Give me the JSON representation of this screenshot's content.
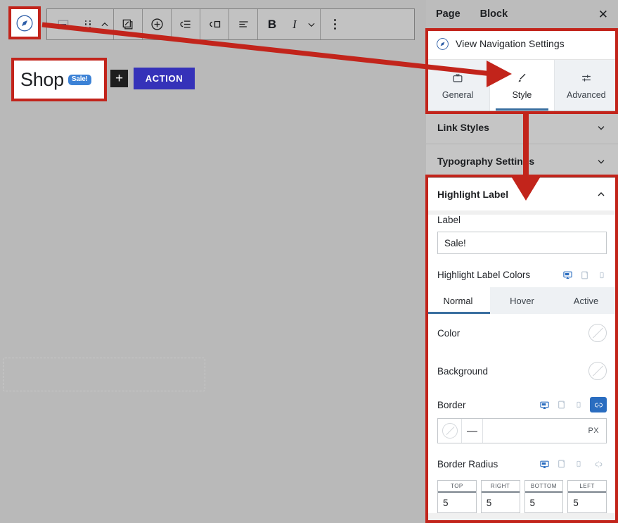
{
  "app": {
    "background_color": "#b9b9b9",
    "accent_color": "#2a6dc0",
    "annotation_color": "#c2241b"
  },
  "canvas": {
    "nav_icon": "compass-icon",
    "toolbar": {
      "groups": [
        {
          "buttons": [
            {
              "icon": "block-type-navigation-icon",
              "label": ""
            },
            {
              "icon": "drag-handle-icon",
              "label": ""
            },
            {
              "icon": "move-up-icon",
              "label": ""
            }
          ]
        },
        {
          "buttons": [
            {
              "icon": "edit-overlay-icon",
              "label": ""
            }
          ]
        },
        {
          "buttons": [
            {
              "icon": "add-circle-icon",
              "label": ""
            }
          ]
        },
        {
          "buttons": [
            {
              "icon": "indent-list-icon",
              "label": ""
            }
          ]
        },
        {
          "buttons": [
            {
              "icon": "submenu-icon",
              "label": ""
            }
          ]
        },
        {
          "buttons": [
            {
              "icon": "align-icon",
              "label": ""
            }
          ]
        },
        {
          "buttons": [
            {
              "icon": "bold-icon",
              "label": "B"
            },
            {
              "icon": "italic-icon",
              "label": "I"
            },
            {
              "icon": "chevron-down-icon",
              "label": ""
            }
          ]
        },
        {
          "buttons": [
            {
              "icon": "more-options-icon",
              "label": ""
            }
          ]
        }
      ]
    },
    "menu_block": {
      "item_label": "Shop",
      "highlight_badge": "Sale!",
      "add_button": "+",
      "action_button": "ACTION"
    }
  },
  "panel": {
    "header": {
      "tab_page": "Page",
      "tab_block": "Block",
      "close_icon": "close-icon"
    },
    "nav_settings": {
      "icon": "compass-icon",
      "title": "View Navigation Settings"
    },
    "segment_tabs": [
      {
        "label": "General",
        "icon": "general-box-icon",
        "active": false
      },
      {
        "label": "Style",
        "icon": "brush-icon",
        "active": true
      },
      {
        "label": "Advanced",
        "icon": "sliders-icon",
        "active": false
      }
    ],
    "accordions": [
      {
        "title": "Link Styles",
        "open": false,
        "chevron": "chevron-down-icon"
      },
      {
        "title": "Typography Settings",
        "open": false,
        "chevron": "chevron-down-icon"
      }
    ],
    "highlight_label_section": {
      "title": "Highlight Label",
      "chevron": "chevron-up-icon",
      "label_field": {
        "label": "Label",
        "value": "Sale!",
        "placeholder": "Sale!"
      },
      "colors": {
        "title": "Highlight Label Colors",
        "devices": [
          {
            "name": "desktop-icon",
            "active": true
          },
          {
            "name": "tablet-icon",
            "active": false
          },
          {
            "name": "mobile-icon",
            "active": false
          }
        ],
        "state_tabs": [
          {
            "label": "Normal",
            "active": true
          },
          {
            "label": "Hover",
            "active": false
          },
          {
            "label": "Active",
            "active": false
          }
        ],
        "rows": [
          {
            "label": "Color",
            "swatch": "none"
          },
          {
            "label": "Background",
            "swatch": "none"
          }
        ]
      },
      "border": {
        "title": "Border",
        "devices": [
          {
            "name": "desktop-icon",
            "active": true
          },
          {
            "name": "tablet-icon",
            "active": false
          },
          {
            "name": "mobile-icon",
            "active": false
          }
        ],
        "link_icon": "link-icon",
        "link_active": true,
        "style_value": "",
        "width_value": "",
        "unit": "PX"
      },
      "border_radius": {
        "title": "Border Radius",
        "devices": [
          {
            "name": "desktop-icon",
            "active": true
          },
          {
            "name": "tablet-icon",
            "active": false
          },
          {
            "name": "mobile-icon",
            "active": false
          }
        ],
        "link_icon": "unlink-icon",
        "link_active": false,
        "fields": [
          {
            "label": "TOP",
            "value": "5"
          },
          {
            "label": "RIGHT",
            "value": "5"
          },
          {
            "label": "BOTTOM",
            "value": "5"
          },
          {
            "label": "LEFT",
            "value": "5"
          }
        ]
      }
    }
  }
}
